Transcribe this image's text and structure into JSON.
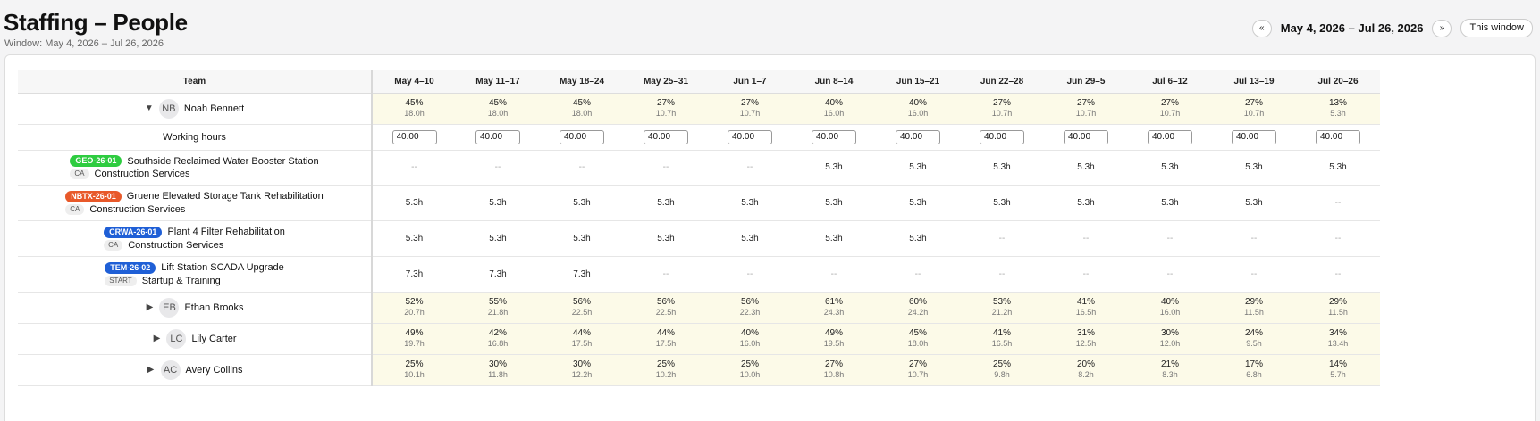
{
  "page": {
    "title": "Staffing – People",
    "subtitle": "Window: May 4, 2026 – Jul 26, 2026"
  },
  "nav": {
    "prev_label": "«",
    "range": "May 4, 2026 – Jul 26, 2026",
    "next_label": "»",
    "this_window_label": "This window"
  },
  "table": {
    "team_header": "Team",
    "weeks": [
      "May 4–10",
      "May 11–17",
      "May 18–24",
      "May 25–31",
      "Jun 1–7",
      "Jun 8–14",
      "Jun 15–21",
      "Jun 22–28",
      "Jun 29–5",
      "Jul 6–12",
      "Jul 13–19",
      "Jul 20–26"
    ]
  },
  "noah": {
    "caret": "▼",
    "initials": "NB",
    "name": "Noah Bennett",
    "pct": [
      "45%",
      "45%",
      "45%",
      "27%",
      "27%",
      "40%",
      "40%",
      "27%",
      "27%",
      "27%",
      "27%",
      "13%"
    ],
    "hrs": [
      "18.0h",
      "18.0h",
      "18.0h",
      "10.7h",
      "10.7h",
      "16.0h",
      "16.0h",
      "10.7h",
      "10.7h",
      "10.7h",
      "10.7h",
      "5.3h"
    ],
    "working_hours_label": "Working hours",
    "working_hours": [
      "40.00",
      "40.00",
      "40.00",
      "40.00",
      "40.00",
      "40.00",
      "40.00",
      "40.00",
      "40.00",
      "40.00",
      "40.00",
      "40.00"
    ],
    "projects": [
      {
        "code": "GEO-26-01",
        "color": "#2ecc40",
        "name": "Southside Reclaimed Water Booster Station",
        "role": "CA",
        "dept": "Construction Services",
        "values": [
          "--",
          "--",
          "--",
          "--",
          "--",
          "5.3h",
          "5.3h",
          "5.3h",
          "5.3h",
          "5.3h",
          "5.3h",
          "5.3h"
        ]
      },
      {
        "code": "NBTX-26-01",
        "color": "#e8592a",
        "name": "Gruene Elevated Storage Tank Rehabilitation",
        "role": "CA",
        "dept": "Construction Services",
        "values": [
          "5.3h",
          "5.3h",
          "5.3h",
          "5.3h",
          "5.3h",
          "5.3h",
          "5.3h",
          "5.3h",
          "5.3h",
          "5.3h",
          "5.3h",
          "--"
        ]
      },
      {
        "code": "CRWA-26-01",
        "color": "#1f5fd6",
        "name": "Plant 4 Filter Rehabilitation",
        "role": "CA",
        "dept": "Construction Services",
        "values": [
          "5.3h",
          "5.3h",
          "5.3h",
          "5.3h",
          "5.3h",
          "5.3h",
          "5.3h",
          "--",
          "--",
          "--",
          "--",
          "--"
        ]
      },
      {
        "code": "TEM-26-02",
        "color": "#1f5fd6",
        "name": "Lift Station SCADA Upgrade",
        "role": "START",
        "dept": "Startup & Training",
        "values": [
          "7.3h",
          "7.3h",
          "7.3h",
          "--",
          "--",
          "--",
          "--",
          "--",
          "--",
          "--",
          "--",
          "--"
        ]
      }
    ]
  },
  "people": [
    {
      "caret": "▶",
      "initials": "EB",
      "name": "Ethan Brooks",
      "pct": [
        "52%",
        "55%",
        "56%",
        "56%",
        "56%",
        "61%",
        "60%",
        "53%",
        "41%",
        "40%",
        "29%",
        "29%"
      ],
      "hrs": [
        "20.7h",
        "21.8h",
        "22.5h",
        "22.5h",
        "22.3h",
        "24.3h",
        "24.2h",
        "21.2h",
        "16.5h",
        "16.0h",
        "11.5h",
        "11.5h"
      ]
    },
    {
      "caret": "▶",
      "initials": "LC",
      "name": "Lily Carter",
      "pct": [
        "49%",
        "42%",
        "44%",
        "44%",
        "40%",
        "49%",
        "45%",
        "41%",
        "31%",
        "30%",
        "24%",
        "34%"
      ],
      "hrs": [
        "19.7h",
        "16.8h",
        "17.5h",
        "17.5h",
        "16.0h",
        "19.5h",
        "18.0h",
        "16.5h",
        "12.5h",
        "12.0h",
        "9.5h",
        "13.4h"
      ]
    },
    {
      "caret": "▶",
      "initials": "AC",
      "name": "Avery Collins",
      "pct": [
        "25%",
        "30%",
        "30%",
        "25%",
        "25%",
        "27%",
        "27%",
        "25%",
        "20%",
        "21%",
        "17%",
        "14%"
      ],
      "hrs": [
        "10.1h",
        "11.8h",
        "12.2h",
        "10.2h",
        "10.0h",
        "10.8h",
        "10.7h",
        "9.8h",
        "8.2h",
        "8.3h",
        "6.8h",
        "5.7h"
      ]
    }
  ]
}
